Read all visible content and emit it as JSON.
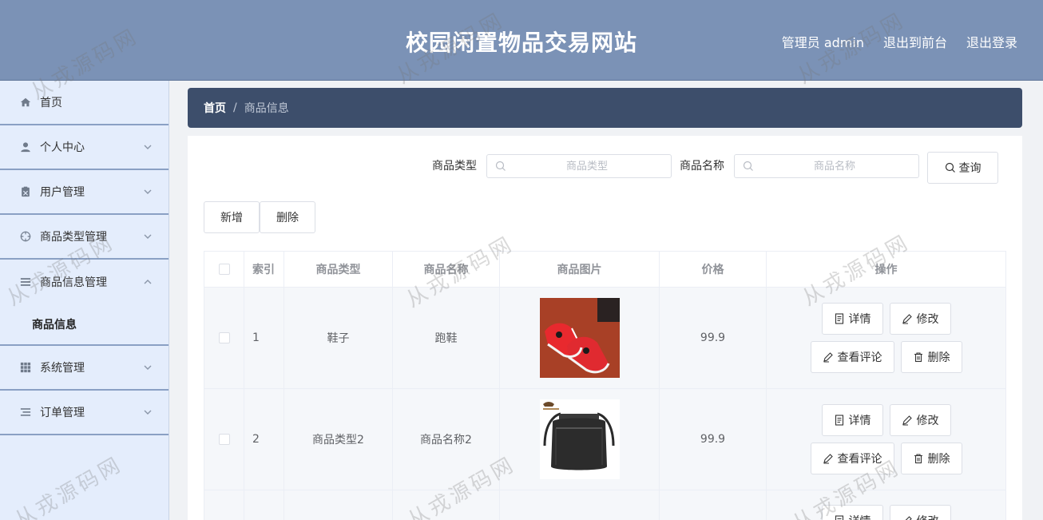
{
  "header": {
    "title": "校园闲置物品交易网站",
    "user_label": "管理员 admin",
    "front_link": "退出到前台",
    "logout_link": "退出登录"
  },
  "sidebar": {
    "items": [
      {
        "label": "首页",
        "icon": "home-icon"
      },
      {
        "label": "个人中心",
        "icon": "user-icon"
      },
      {
        "label": "用户管理",
        "icon": "clipboard-icon"
      },
      {
        "label": "商品类型管理",
        "icon": "compass-icon"
      },
      {
        "label": "商品信息管理",
        "icon": "menu-icon"
      },
      {
        "label": "系统管理",
        "icon": "grid-icon"
      },
      {
        "label": "订单管理",
        "icon": "list-icon"
      }
    ],
    "submenu": {
      "label": "商品信息"
    }
  },
  "breadcrumb": {
    "home": "首页",
    "separator": "/",
    "current": "商品信息"
  },
  "search": {
    "type_label": "商品类型",
    "type_placeholder": "商品类型",
    "name_label": "商品名称",
    "name_placeholder": "商品名称",
    "query_button": "查询"
  },
  "actions": {
    "add": "新增",
    "delete": "删除"
  },
  "table": {
    "headers": [
      "索引",
      "商品类型",
      "商品名称",
      "商品图片",
      "价格",
      "操作"
    ],
    "rows": [
      {
        "index": "1",
        "type": "鞋子",
        "name": "跑鞋",
        "price": "99.9"
      },
      {
        "index": "2",
        "type": "商品类型2",
        "name": "商品名称2",
        "price": "99.9"
      }
    ],
    "ops": {
      "detail": "详情",
      "edit": "修改",
      "comments": "查看评论",
      "delete": "删除"
    }
  },
  "watermark": "从戎源码网",
  "colors": {
    "header": "#7b92b6",
    "sidebar": "#e4edfc",
    "breadcrumb": "#3d4e6b"
  }
}
